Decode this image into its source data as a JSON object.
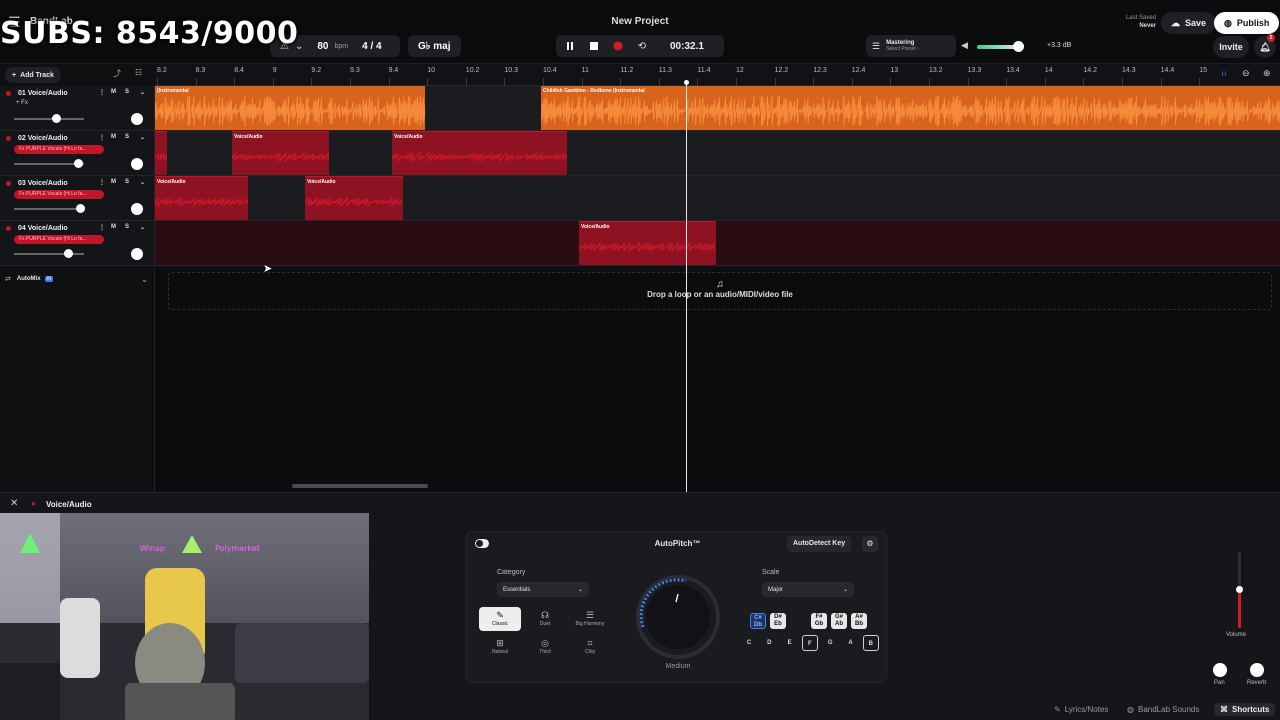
{
  "overlay": {
    "subs": "SUBS: 8543/9000"
  },
  "app": {
    "logo": "BandLab",
    "project_title": "New Project"
  },
  "toolbar": {
    "bpm_value": "80",
    "bpm_unit": "bpm",
    "time_sig": "4 / 4",
    "key": "G♭ maj",
    "time": "00:32.1"
  },
  "mastering": {
    "title": "Mastering",
    "subtitle": "Select Preset ›",
    "db": "+3.3 dB"
  },
  "save_info": {
    "last_saved_label": "Last Saved",
    "last_saved_value": "Never"
  },
  "actions": {
    "save": "Save",
    "publish": "Publish",
    "invite": "Invite",
    "notif_count": "2",
    "add_track": "Add Track"
  },
  "ruler": {
    "ticks": [
      "8.2",
      "8.3",
      "8.4",
      "9",
      "9.2",
      "9.3",
      "9.4",
      "10",
      "10.2",
      "10.3",
      "10.4",
      "11",
      "11.2",
      "11.3",
      "11.4",
      "12",
      "12.2",
      "12.3",
      "12.4",
      "13",
      "13.2",
      "13.3",
      "13.4",
      "14",
      "14.2",
      "14.3",
      "14.4",
      "15"
    ]
  },
  "tracks": [
    {
      "name": "01  Voice/Audio",
      "fx": "+ Fx"
    },
    {
      "name": "02  Voice/Audio",
      "fx": "Fx PURPLE Vocals (Hi Lo fa..."
    },
    {
      "name": "03  Voice/Audio",
      "fx": "Fx PURPLE Vocals (Hi Lo fa..."
    },
    {
      "name": "04  Voice/Audio",
      "fx": "Fx PURPLE Vocals (Hi Lo fa..."
    }
  ],
  "mixer_labels": {
    "mute": "M",
    "solo": "S"
  },
  "clips": {
    "t1a": "(Instrumental",
    "t1b": "Childish Gambino - Redbone (Instrumental",
    "voice": "Voice/Audio"
  },
  "automix": {
    "label": "AutoMix",
    "badge": "AI"
  },
  "drop": {
    "text": "Drop a loop or an audio/MIDI/video file"
  },
  "bottom_panel": {
    "track_name": "Voice/Audio"
  },
  "autopitch": {
    "title": "AutoPitch™",
    "autodetect": "AutoDetect Key",
    "category_label": "Category",
    "category_value": "Essentials",
    "categories": [
      "Classic",
      "Duet",
      "Big Harmony",
      "Natural",
      "Third",
      "Chip"
    ],
    "knob_value": "Medium",
    "scale_label": "Scale",
    "scale_value": "Major",
    "sharp_keys": [
      "C#\nDb",
      "D#\nEb",
      "F#\nGb",
      "G#\nAb",
      "A#\nBb"
    ],
    "natural_keys": [
      "C",
      "D",
      "E",
      "F",
      "G",
      "A",
      "B"
    ]
  },
  "channel": {
    "volume": "Volume",
    "pan": "Pan",
    "reverb": "Reverb"
  },
  "footer": {
    "lyrics": "Lyrics/Notes",
    "sounds": "BandLab Sounds",
    "shortcuts": "Shortcuts"
  },
  "colors": {
    "orange": "#d8631c",
    "red": "#c0162a",
    "record": "#d21a2b"
  }
}
